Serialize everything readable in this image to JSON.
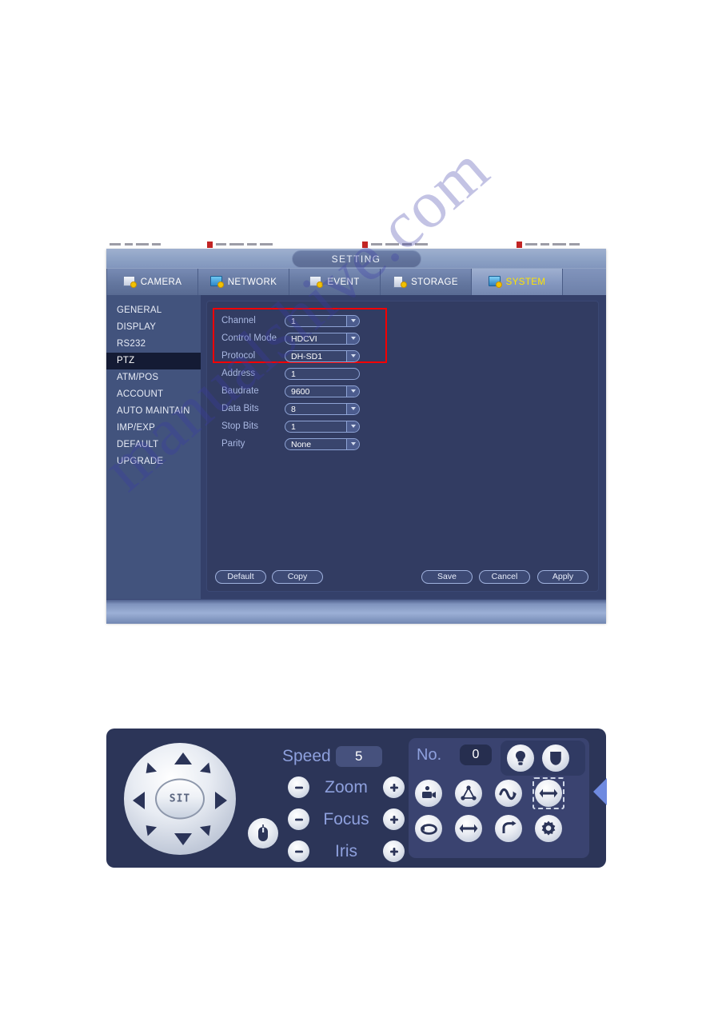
{
  "window": {
    "title": "SETTING",
    "tabs": [
      {
        "label": "CAMERA",
        "icon": "camera-icon",
        "active": false
      },
      {
        "label": "NETWORK",
        "icon": "network-icon",
        "active": false
      },
      {
        "label": "EVENT",
        "icon": "event-icon",
        "active": false
      },
      {
        "label": "STORAGE",
        "icon": "storage-icon",
        "active": false
      },
      {
        "label": "SYSTEM",
        "icon": "system-icon",
        "active": true
      }
    ]
  },
  "sidebar": {
    "items": [
      {
        "label": "GENERAL"
      },
      {
        "label": "DISPLAY"
      },
      {
        "label": "RS232"
      },
      {
        "label": "PTZ"
      },
      {
        "label": "ATM/POS"
      },
      {
        "label": "ACCOUNT"
      },
      {
        "label": "AUTO MAINTAIN"
      },
      {
        "label": "IMP/EXP"
      },
      {
        "label": "DEFAULT"
      },
      {
        "label": "UPGRADE"
      }
    ],
    "active_index": 3
  },
  "form": {
    "fields": [
      {
        "label": "Channel",
        "value": "1",
        "type": "select"
      },
      {
        "label": "Control Mode",
        "value": "HDCVI",
        "type": "select"
      },
      {
        "label": "Protocol",
        "value": "DH-SD1",
        "type": "select"
      },
      {
        "label": "Address",
        "value": "1",
        "type": "text"
      },
      {
        "label": "Baudrate",
        "value": "9600",
        "type": "select"
      },
      {
        "label": "Data Bits",
        "value": "8",
        "type": "select"
      },
      {
        "label": "Stop Bits",
        "value": "1",
        "type": "select"
      },
      {
        "label": "Parity",
        "value": "None",
        "type": "select"
      }
    ]
  },
  "buttons": {
    "default_label": "Default",
    "copy_label": "Copy",
    "save_label": "Save",
    "cancel_label": "Cancel",
    "apply_label": "Apply"
  },
  "ptz": {
    "center_label": "SIT",
    "speed_label": "Speed",
    "speed_value": "5",
    "no_label": "No.",
    "no_value": "0",
    "controls": [
      {
        "name": "Zoom"
      },
      {
        "name": "Focus"
      },
      {
        "name": "Iris"
      }
    ],
    "top_buttons": [
      {
        "icon": "light-bulb-icon"
      },
      {
        "icon": "wiper-icon"
      }
    ],
    "grid_buttons": [
      {
        "icon": "preset-icon"
      },
      {
        "icon": "tour-icon"
      },
      {
        "icon": "pattern-icon"
      },
      {
        "icon": "auto-scan-icon"
      },
      {
        "icon": "auto-pan-icon"
      },
      {
        "icon": "flip-icon"
      },
      {
        "icon": "reset-icon"
      },
      {
        "icon": "config-gear-icon"
      }
    ]
  },
  "watermark": {
    "text": "manualshive.com"
  },
  "colors": {
    "panel_bg": "#323c62",
    "sidebar_bg": "#42537d",
    "sidebar_active_bg": "#141b34",
    "window_bg": "#34406a",
    "ptz_bg": "#2c3558",
    "accent_label": "#a9b8e2",
    "active_tab_text": "#ffe400",
    "annotation_red": "#f40000",
    "collapse_blue": "#6f8ae0"
  }
}
